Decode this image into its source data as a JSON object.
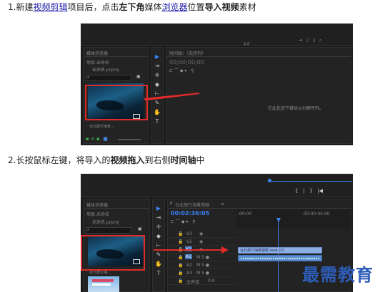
{
  "steps": [
    {
      "num": "1.",
      "t1": "新建",
      "link1": "视频剪辑",
      "t2": "项目后，点击",
      "b1": "左下角",
      "t3": "媒体",
      "link2": "浏览器",
      "t4": "位置",
      "b2": "导入视频",
      "t5": "素材"
    },
    {
      "num": "2.",
      "t1": "长按鼠标左键，将导入的",
      "b1": "视频拖入",
      "t2": "到右侧",
      "b2": "时间轴",
      "t3": "中"
    }
  ],
  "shot1": {
    "panel_title": "媒体浏览器",
    "project_label": "项目:未命名",
    "file_label": "未命名.prproj",
    "timeline_tab": "时间轴：（无序列）",
    "timecode": "00;00;00;00",
    "empty_hint": "在此处放下媒体以创建序列。",
    "clip_name": "台北旅行海景..."
  },
  "shot2": {
    "panel_title": "媒体浏览器",
    "project_label": "项目:未命名",
    "file_label": "未命名.prproj",
    "timeline_tab": "台北旅行海景视频",
    "timecode": "00:02:36:05",
    "ruler_start": ":00:00",
    "ruler_end": "00:00:05:00",
    "clip_label": "台北旅行海景视频.mp4 [V]",
    "clip_name": "台北旅行海...",
    "track_labels": [
      "V3",
      "V2",
      "V1",
      "A1",
      "A2",
      "A3"
    ],
    "master_label": "主声道",
    "master_value": "0.0"
  },
  "watermark": "最需教育"
}
